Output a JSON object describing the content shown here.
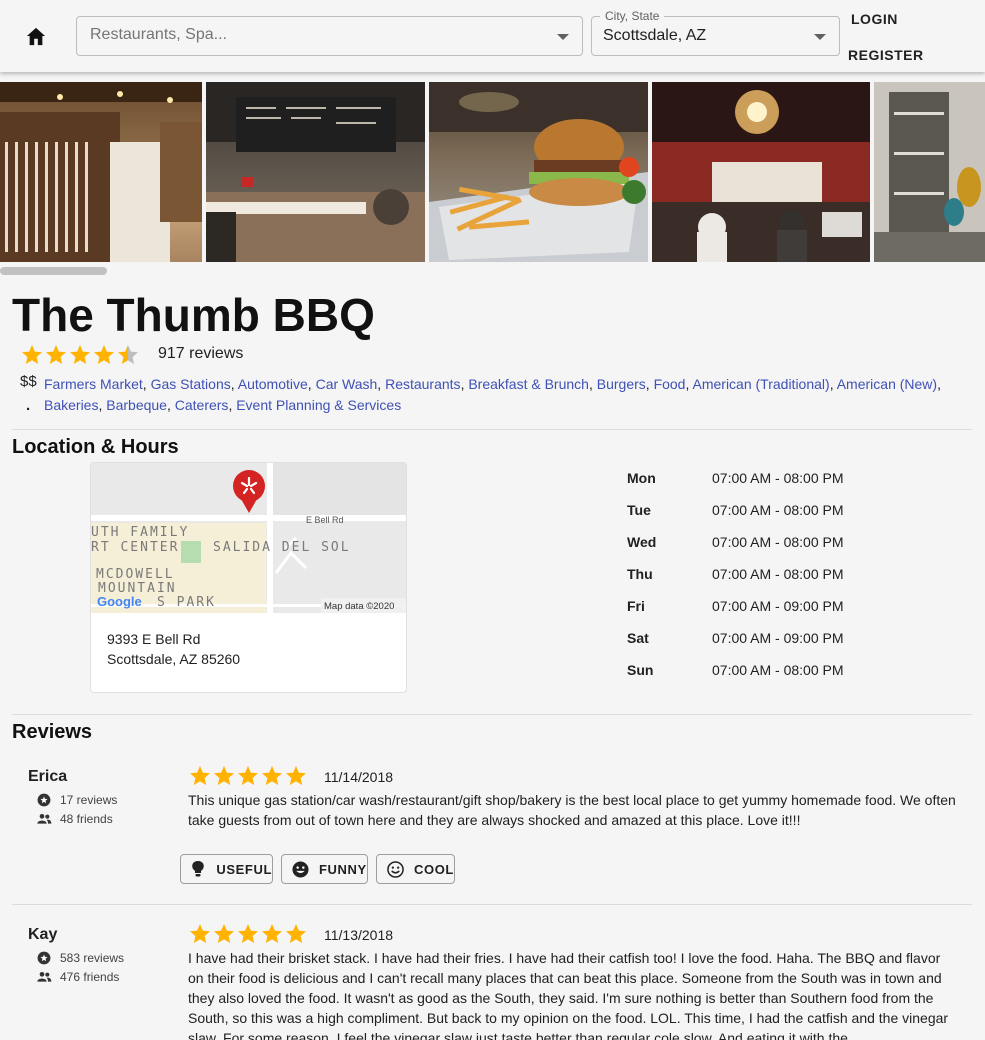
{
  "header": {
    "search_placeholder": "Restaurants, Spa...",
    "city_label": "City, State",
    "city_value": "Scottsdale, AZ",
    "login": "LOGIN",
    "register": "REGISTER"
  },
  "business": {
    "name": "The Thumb BBQ",
    "rating": 4.5,
    "review_count": "917 reviews",
    "price": "$$",
    "categories": [
      "Farmers Market",
      "Gas Stations",
      "Automotive",
      "Car Wash",
      "Restaurants",
      "Breakfast & Brunch",
      "Burgers",
      "Food",
      "American (Traditional)",
      "American (New)",
      "Bakeries",
      "Barbeque",
      "Caterers",
      "Event Planning & Services"
    ]
  },
  "location": {
    "section_title": "Location & Hours",
    "map_labels": {
      "street": "E Bell Rd",
      "line1": "UTH FAMILY",
      "line2": "RT CENTER",
      "line3": "SALIDA DEL SOL",
      "line4": "MCDOWELL",
      "line5": "MOUNTAIN",
      "line6": "S PARK",
      "google": "Google",
      "credit": "Map data ©2020"
    },
    "address_line1": "9393 E Bell Rd",
    "address_line2": "Scottsdale, AZ 85260",
    "hours": [
      {
        "day": "Mon",
        "hours": "07:00 AM - 08:00 PM"
      },
      {
        "day": "Tue",
        "hours": "07:00 AM - 08:00 PM"
      },
      {
        "day": "Wed",
        "hours": "07:00 AM - 08:00 PM"
      },
      {
        "day": "Thu",
        "hours": "07:00 AM - 08:00 PM"
      },
      {
        "day": "Fri",
        "hours": "07:00 AM - 09:00 PM"
      },
      {
        "day": "Sat",
        "hours": "07:00 AM - 09:00 PM"
      },
      {
        "day": "Sun",
        "hours": "07:00 AM - 08:00 PM"
      }
    ]
  },
  "reviews": {
    "section_title": "Reviews",
    "items": [
      {
        "name": "Erica",
        "review_count": "17 reviews",
        "friends": "48 friends",
        "rating": 5,
        "date": "11/14/2018",
        "text": "This unique gas station/car wash/restaurant/gift shop/bakery is the best local place to get yummy homemade food. We often take guests from out of town here and they are always shocked and amazed at this place. Love it!!!"
      },
      {
        "name": "Kay",
        "review_count": "583 reviews",
        "friends": "476 friends",
        "rating": 5,
        "date": "11/13/2018",
        "text": "I have had their brisket stack. I have had their fries. I have had their catfish too! I love the food. Haha. The BBQ and flavor on their food is delicious and I can't recall many places that can beat this place. Someone from the South was in town and they also loved the food. It wasn't as good as the South, they said. I'm sure nothing is better than Southern food from the South, so this was a high compliment. But back to my opinion on the food. LOL. This time, I had the catfish and the vinegar slaw. For some reason, I feel the vinegar slaw just taste better than regular cole slow. And eating it with the"
      }
    ],
    "votes": {
      "useful": "USEFUL",
      "funny": "FUNNY",
      "cool": "COOL"
    }
  },
  "colors": {
    "star": "#ffb300",
    "link": "#3f51b5",
    "pin": "#d32323"
  },
  "icons": [
    "home-icon",
    "dropdown-arrow-icon",
    "star-icon",
    "review-badge-icon",
    "friends-icon",
    "lightbulb-icon",
    "smiley-icon",
    "cool-smiley-icon",
    "map-pin-icon"
  ]
}
